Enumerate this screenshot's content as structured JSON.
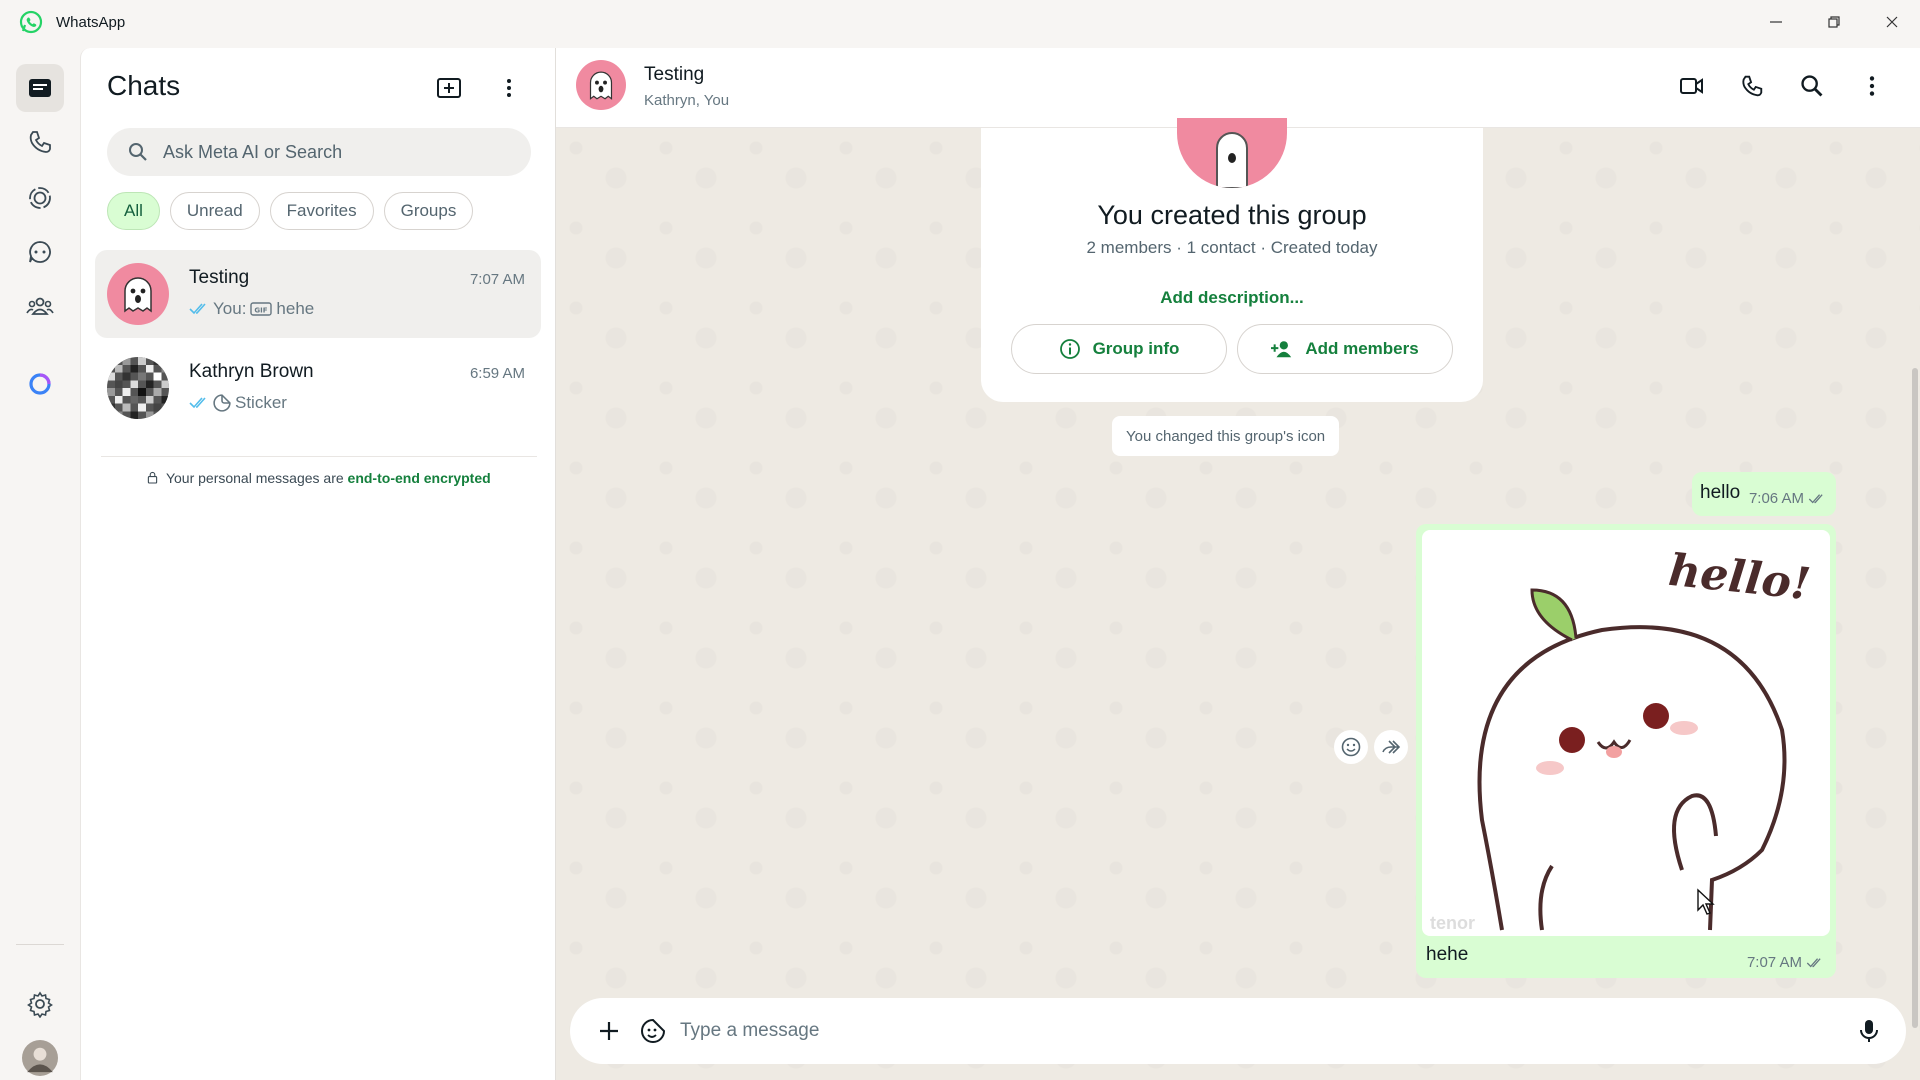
{
  "window": {
    "title": "WhatsApp",
    "controls": [
      "minimize-icon",
      "restore-icon",
      "close-icon"
    ]
  },
  "rail": {
    "items": [
      "chats-icon",
      "calls-icon",
      "status-icon",
      "channels-icon",
      "communities-icon",
      "meta-ai-icon"
    ],
    "bottom": [
      "settings-icon",
      "profile-avatar"
    ]
  },
  "chatlist": {
    "title": "Chats",
    "search_placeholder": "Ask Meta AI or Search",
    "filters": [
      "All",
      "Unread",
      "Favorites",
      "Groups"
    ],
    "active_filter": "All",
    "chats": [
      {
        "name": "Testing",
        "time": "7:07 AM",
        "preview_prefix": "You:",
        "preview_type_icon": "gif-icon",
        "preview_text": "hehe",
        "selected": true
      },
      {
        "name": "Kathryn Brown",
        "time": "6:59 AM",
        "preview_prefix": "",
        "preview_type_icon": "sticker-icon",
        "preview_text": "Sticker",
        "selected": false
      }
    ],
    "encryption_note": "Your personal messages are",
    "encryption_link": "end-to-end encrypted"
  },
  "conversation": {
    "name": "Testing",
    "subtitle": "Kathryn, You",
    "header_actions": [
      "video-call-icon",
      "voice-call-icon",
      "search-icon",
      "more-options-icon"
    ],
    "group_card": {
      "title": "You created this group",
      "subtitle": "2 members · 1 contact · Created today",
      "add_description": "Add description...",
      "group_info_label": "Group info",
      "add_members_label": "Add members"
    },
    "system_message": "You changed this group's icon",
    "messages": [
      {
        "type": "text",
        "text": "hello",
        "time": "7:06 AM",
        "status": "read"
      },
      {
        "type": "gif",
        "gif_text": "hello!",
        "watermark": "tenor",
        "caption": "hehe",
        "time": "7:07 AM",
        "status": "read"
      }
    ],
    "composer_placeholder": "Type a message"
  },
  "colors": {
    "accent": "#15803d",
    "outgoing_bubble": "#d9fdd3",
    "chat_background": "#efeae2",
    "avatar_pink": "#f08aa0"
  }
}
